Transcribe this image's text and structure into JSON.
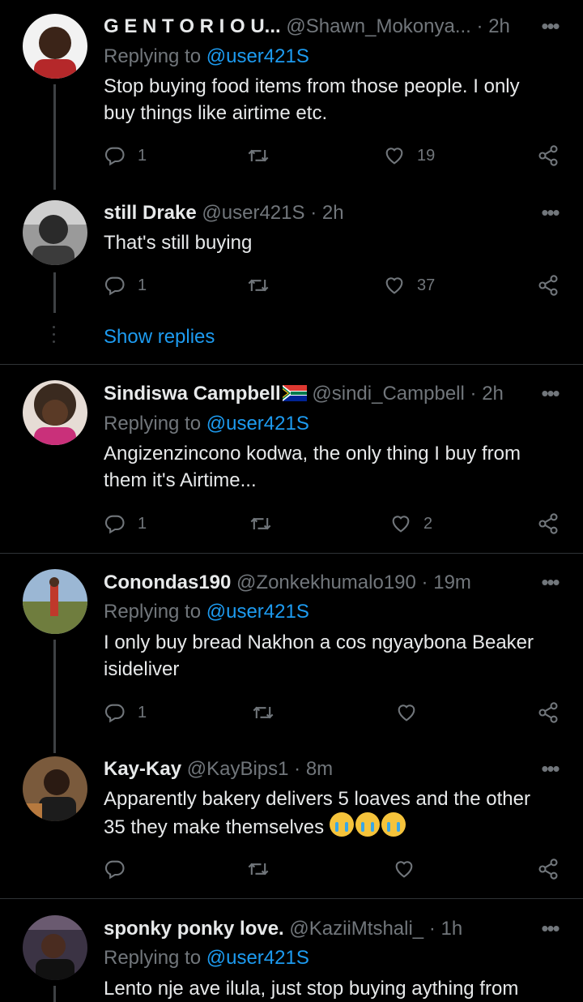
{
  "tweets": [
    {
      "name": "G E N T O R I O U...",
      "handle": "@Shawn_Mokonya...",
      "time": "2h",
      "replying_prefix": "Replying to",
      "replying_to": "@user421S",
      "text": "Stop buying food items from those people. I only buy things like airtime etc.",
      "replies": "1",
      "likes": "19"
    },
    {
      "name": "still Drake",
      "handle": "@user421S",
      "time": "2h",
      "text": "That's still buying",
      "replies": "1",
      "likes": "37",
      "show_replies": "Show replies"
    },
    {
      "name": "Sindiswa Campbell",
      "handle": "@sindi_Campbell",
      "time": "2h",
      "replying_prefix": "Replying to",
      "replying_to": "@user421S",
      "text": "Angizenzincono kodwa, the only thing I buy from them it's Airtime...",
      "replies": "1",
      "likes": "2"
    },
    {
      "name": "Conondas190",
      "handle": "@Zonkekhumalo190",
      "time": "19m",
      "replying_prefix": "Replying to",
      "replying_to": "@user421S",
      "text": "I only buy bread Nakhon a cos ngyaybona Beaker isideliver",
      "replies": "1",
      "likes": ""
    },
    {
      "name": "Kay-Kay",
      "handle": "@KayBips1",
      "time": "8m",
      "text": "Apparently bakery delivers 5 loaves and the other 35 they make themselves",
      "replies": "",
      "likes": ""
    },
    {
      "name": "sponky ponky love.",
      "handle": "@KaziiMtshali_",
      "time": "1h",
      "replying_prefix": "Replying to",
      "replying_to": "@user421S",
      "text": "Lento nje ave ilula, just stop buying aything from"
    }
  ],
  "separator": "·",
  "colors": {
    "background": "#000000",
    "accent": "#1d9bf0",
    "muted": "#71767b",
    "text": "#e7e9ea"
  },
  "icons": [
    "reply-icon",
    "retweet-icon",
    "like-icon",
    "share-icon",
    "more-icon",
    "flag-za-icon",
    "crying-emoji-icon"
  ]
}
